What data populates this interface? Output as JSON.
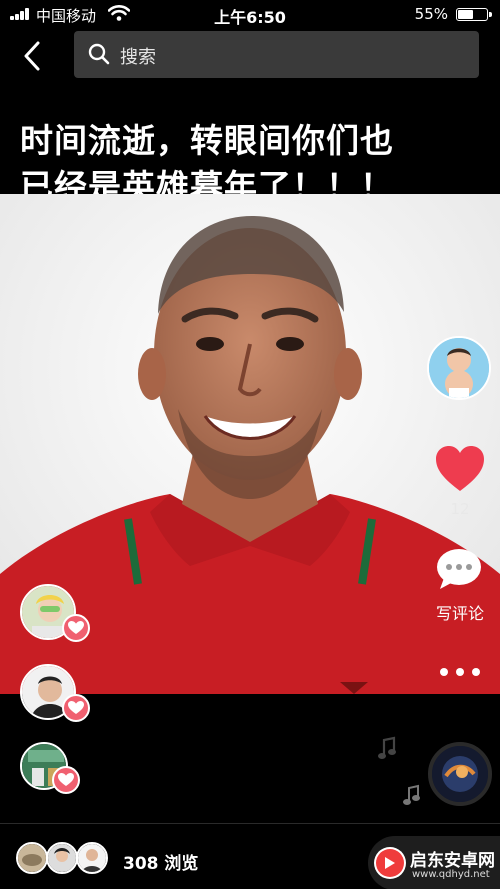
{
  "status_bar": {
    "carrier": "中国移动",
    "time": "上午6:50",
    "battery_percent": "55%",
    "battery_level": 0.55
  },
  "search": {
    "placeholder": "搜索"
  },
  "caption": {
    "line1": "时间流逝，转眼间你们也",
    "line2": "已经是英雄暮年了！！！"
  },
  "actions": {
    "like_count": "12",
    "comment_label": "写评论"
  },
  "footer": {
    "view_count": "308 浏览"
  },
  "watermark": {
    "title": "启东安卓网",
    "url": "www.qdhyd.net"
  },
  "colors": {
    "like_red": "#ee3c4f",
    "badge_pink": "#f06070",
    "jersey_red": "#c81e24",
    "search_bg": "#3a3a3a"
  }
}
